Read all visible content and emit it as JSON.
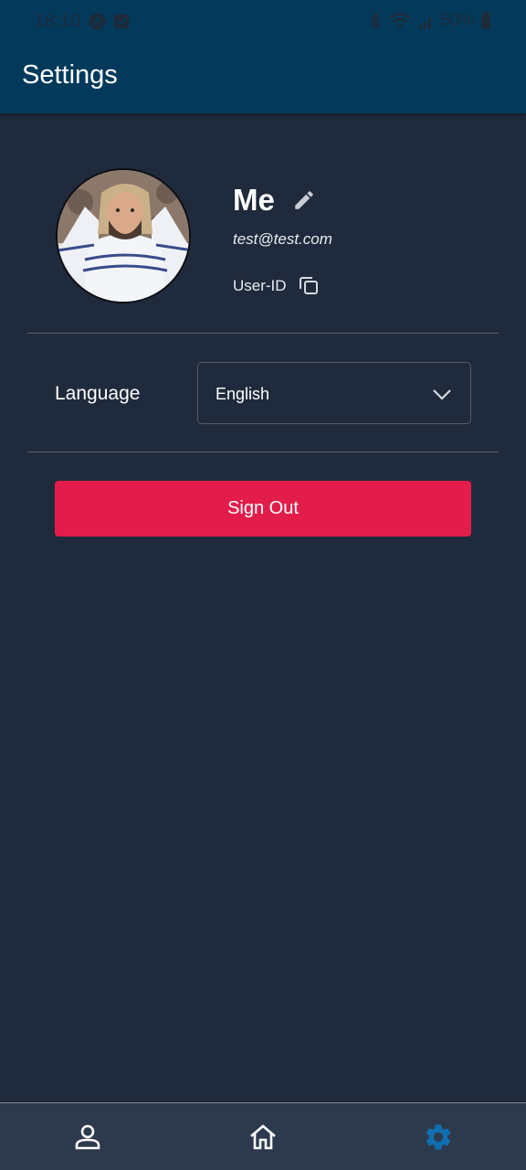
{
  "status_bar": {
    "time": "18:10",
    "battery": "50%"
  },
  "app_bar": {
    "title": "Settings"
  },
  "profile": {
    "name": "Me",
    "email": "test@test.com",
    "user_id_label": "User-ID"
  },
  "language": {
    "label": "Language",
    "selected": "English"
  },
  "actions": {
    "sign_out": "Sign Out"
  },
  "bottom_nav": {
    "items": [
      {
        "icon": "person-icon",
        "active": false
      },
      {
        "icon": "home-icon",
        "active": false
      },
      {
        "icon": "gear-icon",
        "active": true
      }
    ]
  },
  "colors": {
    "app_bar": "#033a5b",
    "background": "#1f2a3c",
    "sign_out": "#e21d4b",
    "bottom_nav": "#2d3a4d",
    "active_nav": "#0f6fb0"
  }
}
